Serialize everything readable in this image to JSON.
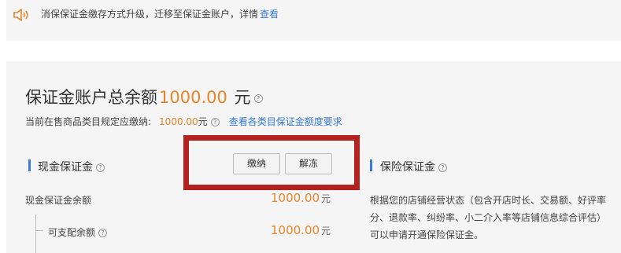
{
  "notice": {
    "icon": "speaker-icon",
    "text": "消保保证金缴存方式升级，迁移至保证金账户，详情",
    "link": "查看"
  },
  "account": {
    "title": "保证金账户总余额",
    "amount": "1000.00",
    "unit": "元",
    "required_label": "当前在售商品类目规定应缴纳:",
    "required_amount": "1000.00",
    "required_unit": "元",
    "requirements_link": "查看各类目保证金额度要求"
  },
  "cash": {
    "title": "现金保证金",
    "pay_button": "缴纳",
    "release_button": "解冻",
    "balance_label": "现金保证金余额",
    "balance_amount": "1000.00",
    "balance_unit": "元",
    "available_label": "可支配余额",
    "available_amount": "1000.00",
    "available_unit": "元"
  },
  "insurance": {
    "title": "保险保证金",
    "line1": "根据您的店铺经营状态（包含开店时长、交易额、好评率",
    "line2": "分、退款率、纠纷率、小二介入率等店铺信息综合评估）",
    "line3": "可以申请开通保险保证金。"
  },
  "colors": {
    "accent_orange": "#e8852b",
    "link_blue": "#3a7bd5",
    "highlight_red": "#b3221e"
  }
}
